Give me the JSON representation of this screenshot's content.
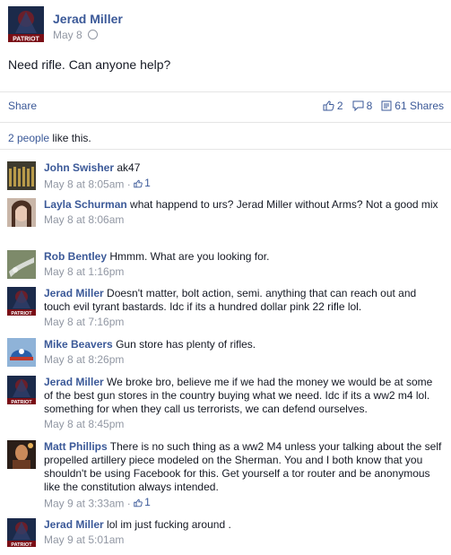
{
  "post": {
    "author": "Jerad Miller",
    "date": "May 8",
    "text": "Need rifle. Can anyone help?"
  },
  "actions": {
    "share": "Share",
    "likes": "2",
    "comments": "8",
    "shares": "61 Shares"
  },
  "likes_summary": {
    "people": "2 people",
    "rest": " like this."
  },
  "comments": [
    {
      "name": "John Swisher",
      "text": "ak47",
      "time": "May 8 at 8:05am",
      "likes": "1"
    },
    {
      "name": "Layla Schurman",
      "text": "what happend to urs? Jerad Miller without Arms? Not a good mix",
      "time": "May 8 at 8:06am"
    },
    {
      "name": "Rob Bentley",
      "text": "Hmmm. What are you looking for.",
      "time": "May 8 at 1:16pm"
    },
    {
      "name": "Jerad Miller",
      "text": "Doesn't matter, bolt action, semi. anything that can reach out and touch evil tyrant bastards. Idc if its a hundred dollar pink 22 rifle lol.",
      "time": "May 8 at 7:16pm"
    },
    {
      "name": "Mike Beavers",
      "text": "Gun store has plenty of rifles.",
      "time": "May 8 at 8:26pm"
    },
    {
      "name": "Jerad Miller",
      "text": "We broke bro, believe me if we had the money we would be at some of the best gun stores in the country buying what we need. Idc if its a ww2 m4 lol. something for when they call us terrorists, we can defend ourselves.",
      "time": "May 8 at 8:45pm"
    },
    {
      "name": "Matt Phillips",
      "text": "There is no such thing as a ww2 M4 unless your talking about the self propelled artillery piece modeled on the Sherman. You and I both know that you shouldn't be using Facebook for this. Get yourself a tor router and be anonymous like the constitution always intended.",
      "time": "May 9 at 3:33am",
      "likes": "1"
    },
    {
      "name": "Jerad Miller",
      "text": "lol im just fucking around .",
      "time": "May 9 at 5:01am"
    }
  ],
  "meta": {
    "separator": " · "
  },
  "avatar_text": "PATRIOT",
  "colors": {
    "link": "#3b5998",
    "meta": "#9197a3",
    "border": "#e5e5e5"
  }
}
